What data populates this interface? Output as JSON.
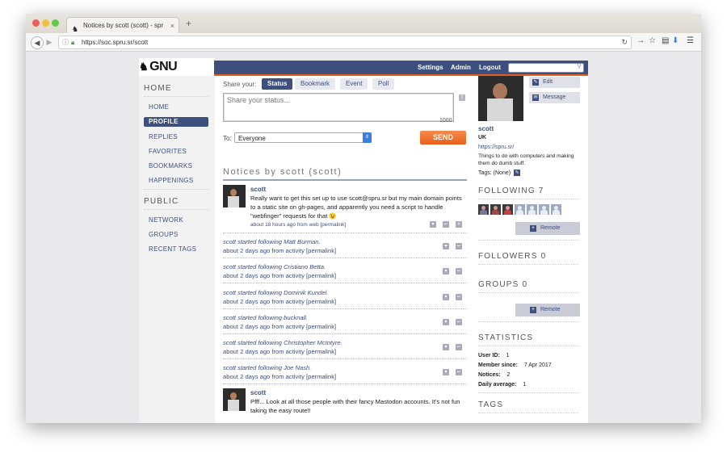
{
  "browser": {
    "tab_title": "Notices by scott (scott) - spr​",
    "new_tab": "+",
    "tab_close": "×",
    "url": "https://soc.spru.sr/scott"
  },
  "site": {
    "logo": "GNU social",
    "nav": [
      "Settings",
      "Admin",
      "Logout"
    ]
  },
  "left_nav": {
    "home_head": "HOME",
    "home_items": [
      "HOME",
      "PROFILE",
      "REPLIES",
      "FAVORITES",
      "BOOKMARKS",
      "HAPPENINGS"
    ],
    "public_head": "PUBLIC",
    "public_items": [
      "NETWORK",
      "GROUPS",
      "RECENT TAGS"
    ]
  },
  "composer": {
    "share_label": "Share your:",
    "tabs": [
      "Status",
      "Bookmark",
      "Event",
      "Poll"
    ],
    "placeholder": "Share your status...",
    "counter": "1000",
    "to_label": "To:",
    "to_value": "Everyone",
    "send": "SEND"
  },
  "notices_heading": "Notices by scott (scott)",
  "notice1": {
    "user": "scott",
    "text": "Really want to get this set up to use scott@spru.sr but my main domain points to a static site on gh-pages, and apparently you need a script to handle \"webfinger\" requests for that 😉",
    "meta": "about 18 hours ago from web [permalink]"
  },
  "follows": [
    {
      "text": "scott started following Matt Burman.",
      "meta": "about 2 days ago from activity [permalink]"
    },
    {
      "text": "scott started following Cristiano Betta.",
      "meta": "about 2 days ago from activity [permalink]"
    },
    {
      "text": "scott started following Dominik Kundel.",
      "meta": "about 2 days ago from activity [permalink]"
    },
    {
      "text": "scott started following bucknall.",
      "meta": "about 2 days ago from activity [permalink]"
    },
    {
      "text": "scott started following Christopher McIntyre.",
      "meta": "about 2 days ago from activity [permalink]"
    },
    {
      "text": "scott started following Joe Nash.",
      "meta": "about 2 days ago from activity [permalink]"
    }
  ],
  "notice2": {
    "user": "scott",
    "text": "Pfff... Look at all those people with their fancy Mastodon accounts. It's not fun taking the easy route!!"
  },
  "profile": {
    "edit": "Edit",
    "message": "Message",
    "name": "scott",
    "location": "UK",
    "url": "https://spru.sr/",
    "bio": "Things to do with computers and making them do dumb stuff.",
    "tags": "Tags:  (None)"
  },
  "sidebar": {
    "following_head": "FOLLOWING",
    "following_count": "7",
    "remote": "Remote",
    "followers_head": "FOLLOWERS",
    "followers_count": "0",
    "groups_head": "GROUPS",
    "groups_count": "0",
    "statistics_head": "STATISTICS",
    "stats": [
      {
        "label": "User ID:",
        "value": "1"
      },
      {
        "label": "Member since:",
        "value": "7 Apr 2017"
      },
      {
        "label": "Notices:",
        "value": "2"
      },
      {
        "label": "Daily average:",
        "value": "1"
      }
    ],
    "tags_head": "TAGS"
  },
  "colors": {
    "accent": "#3d4f7d",
    "send": "#e8601a",
    "nav_underline": "#e25f20"
  }
}
